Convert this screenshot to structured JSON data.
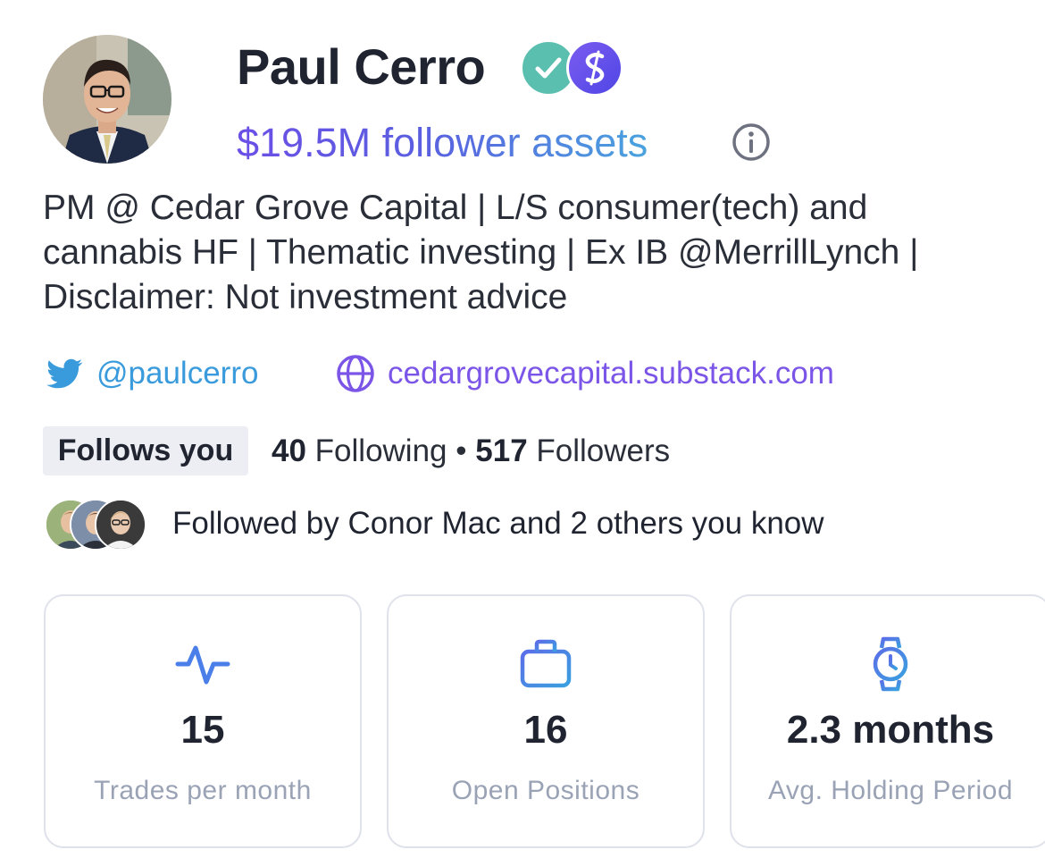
{
  "profile": {
    "name": "Paul Cerro",
    "verified_badge_icon": "verified-check-icon",
    "platform_badge_icon": "s-logo-icon",
    "assets_text": "$19.5M follower assets",
    "bio": "PM @ Cedar Grove Capital | L/S consumer(tech) and\ncannabis HF | Thematic investing | Ex IB @MerrillLynch |\nDisclaimer: Not investment advice"
  },
  "links": {
    "twitter": {
      "icon": "twitter-icon",
      "label": "@paulcerro"
    },
    "website": {
      "icon": "globe-icon",
      "label": "cedargrovecapital.substack.com"
    }
  },
  "social": {
    "follows_you": "Follows you",
    "following_count": "40",
    "following_label": "Following",
    "separator": "•",
    "followers_count": "517",
    "followers_label": "Followers",
    "followed_by": "Followed by Conor Mac and 2 others you know"
  },
  "stats": [
    {
      "icon": "activity-pulse-icon",
      "value": "15",
      "label": "Trades per month"
    },
    {
      "icon": "briefcase-icon",
      "value": "16",
      "label": "Open Positions"
    },
    {
      "icon": "watch-icon",
      "value": "2.3 months",
      "label": "Avg. Holding Period"
    }
  ],
  "colors": {
    "accent_purple": "#6b4fe6",
    "accent_blue": "#4aa3de",
    "twitter_blue": "#3a9bdc",
    "link_purple": "#7b55e8",
    "verified_teal": "#5bbfb0",
    "icon_blue": "#4a7ee8",
    "muted_text": "#9aa3b5",
    "card_border": "#dfe2ea"
  }
}
